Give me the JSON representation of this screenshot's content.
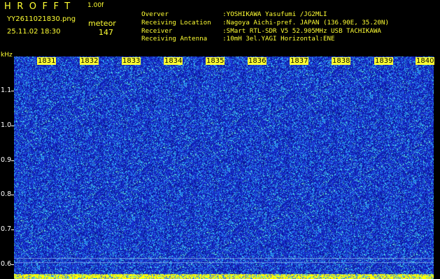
{
  "header": {
    "title": "HROFFT",
    "version": "1.00f",
    "file_name": "YY2611021830.png",
    "type_label": "meteor",
    "timestamp": "25.11.02 18:30",
    "count": "147"
  },
  "station_info": [
    {
      "key": "Overver",
      "value": ":YOSHIKAWA Yasufumi /JG2MLI"
    },
    {
      "key": "Receiving Location",
      "value": ":Nagoya Aichi-pref. JAPAN (136.90E, 35.20N)"
    },
    {
      "key": "Receiver",
      "value": ":SMart RTL-SDR V5 52.905MHz USB TACHIKAWA"
    },
    {
      "key": "Receiving Antenna",
      "value": ":10mH 3el.YAGI Horizontal:ENE"
    }
  ],
  "spectrogram": {
    "y_unit": "kHz",
    "y_ticks": [
      "1.1",
      "1.0",
      "0.9",
      "0.8",
      "0.7",
      "0.6"
    ],
    "x_ticks": [
      "1831",
      "1832",
      "1833",
      "1834",
      "1835",
      "1836",
      "1837",
      "1838",
      "1839",
      "1840"
    ],
    "colors": {
      "background": "#1428c8",
      "noise_low": "#0a1496",
      "noise_mid": "#2850e6",
      "noise_high": "#32c8ff",
      "speck": "#78ffc8",
      "label_bg": "#ffff33",
      "bottom_band": "#ffff00"
    }
  }
}
